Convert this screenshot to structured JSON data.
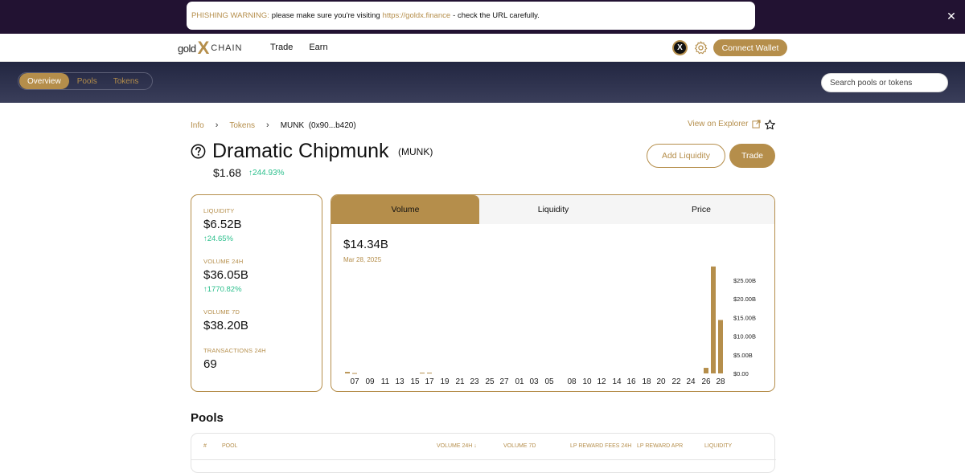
{
  "banner": {
    "warning_label": "PHISHING WARNING:",
    "message": "please make sure you're visiting",
    "url": "https://goldx.finance",
    "suffix": "- check the URL carefully.",
    "close_glyph": "✕"
  },
  "header": {
    "logo_gold": "gold",
    "logo_x": "X",
    "logo_chain": "CHAIN",
    "nav": [
      "Trade",
      "Earn"
    ],
    "connect_label": "Connect Wallet",
    "x_badge": "X"
  },
  "subnav": {
    "tabs": [
      "Overview",
      "Pools",
      "Tokens"
    ],
    "active": "Overview",
    "search_placeholder": "Search pools or tokens"
  },
  "breadcrumb": {
    "items": [
      "Info",
      "Tokens"
    ],
    "current": "MUNK  (0x90...b420)",
    "explorer_label": "View on Explorer"
  },
  "token": {
    "name": "Dramatic Chipmunk",
    "symbol": "(MUNK)",
    "price": "$1.68",
    "change": "↑244.93%",
    "add_liquidity_label": "Add Liquidity",
    "trade_label": "Trade"
  },
  "stats": [
    {
      "label": "LIQUIDITY",
      "value": "$6.52B",
      "change": "↑24.65%"
    },
    {
      "label": "VOLUME 24H",
      "value": "$36.05B",
      "change": "↑1770.82%"
    },
    {
      "label": "VOLUME 7D",
      "value": "$38.20B",
      "change": ""
    },
    {
      "label": "TRANSACTIONS 24H",
      "value": "69",
      "change": ""
    }
  ],
  "chart_tabs": [
    "Volume",
    "Liquidity",
    "Price"
  ],
  "chart_active_tab": "Volume",
  "chart_header": {
    "value": "$14.34B",
    "date": "Mar 28, 2025"
  },
  "chart_data": {
    "type": "bar",
    "x_ticks": [
      "07",
      "09",
      "11",
      "13",
      "15",
      "17",
      "19",
      "21",
      "23",
      "25",
      "27",
      "01",
      "03",
      "05",
      "08",
      "10",
      "12",
      "14",
      "16",
      "18",
      "20",
      "22",
      "24",
      "26",
      "28"
    ],
    "y_ticks": [
      "$25.00B",
      "$20.00B",
      "$15.00B",
      "$10.00B",
      "$5.00B",
      "$0.00"
    ],
    "ylim": [
      0,
      25
    ],
    "y_unit": "B",
    "bars": [
      {
        "x": "07",
        "value": 0.4
      },
      {
        "x": "08",
        "value": 0.1
      },
      {
        "x": "16",
        "value": 0.2
      },
      {
        "x": "17",
        "value": 0.2
      },
      {
        "x": "25",
        "value": 1.5
      },
      {
        "x": "26",
        "value": 28.7
      },
      {
        "x": "27",
        "value": 14.34
      }
    ],
    "color": "#b58e4b"
  },
  "pools": {
    "title": "Pools",
    "columns": [
      "#",
      "POOL",
      "VOLUME 24H ↓",
      "VOLUME 7D",
      "LP REWARD FEES 24H",
      "LP REWARD APR",
      "LIQUIDITY"
    ]
  },
  "colors": {
    "accent": "#b58e4b",
    "positive": "#2bbf8c",
    "banner_bg": "#221232",
    "subbar_bg": "#2b2f4a"
  }
}
